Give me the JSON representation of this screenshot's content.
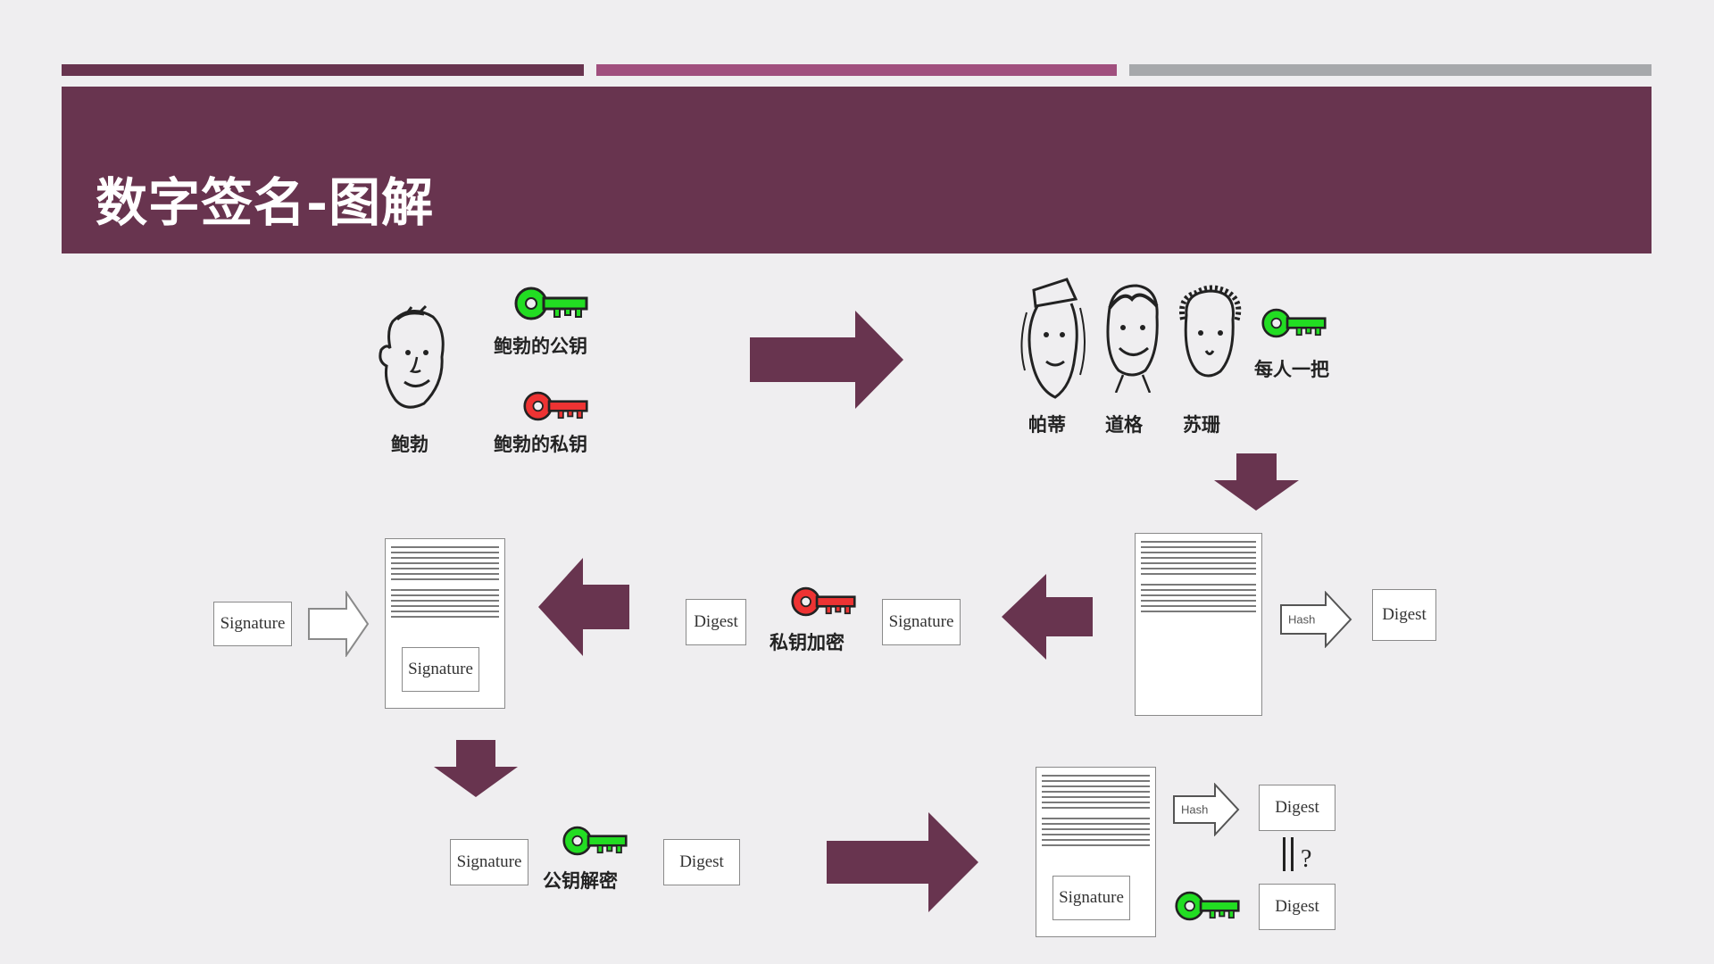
{
  "slide": {
    "title": "数字签名-图解",
    "colors": {
      "accent_dark": "#68344f",
      "accent_mid": "#a04f7e",
      "accent_grey": "#a6a8ab",
      "arrow": "#68344f",
      "key_green": "#22dd22",
      "key_red": "#ee3333"
    }
  },
  "people": {
    "bob_name": "鲍勃",
    "bob_public_key": "鲍勃的公钥",
    "bob_private_key": "鲍勃的私钥",
    "friends": [
      "帕蒂",
      "道格",
      "苏珊"
    ],
    "each_one": "每人一把"
  },
  "flow": {
    "hash_label": "Hash",
    "digest_label": "Digest",
    "signature_label": "Signature",
    "private_encrypt": "私钥加密",
    "public_decrypt": "公钥解密",
    "compare_mark": "?"
  },
  "icons": [
    "green-key-icon",
    "red-key-icon",
    "face-icon",
    "right-arrow-icon",
    "left-arrow-icon",
    "down-arrow-icon",
    "document-icon",
    "hash-arrow-icon"
  ]
}
